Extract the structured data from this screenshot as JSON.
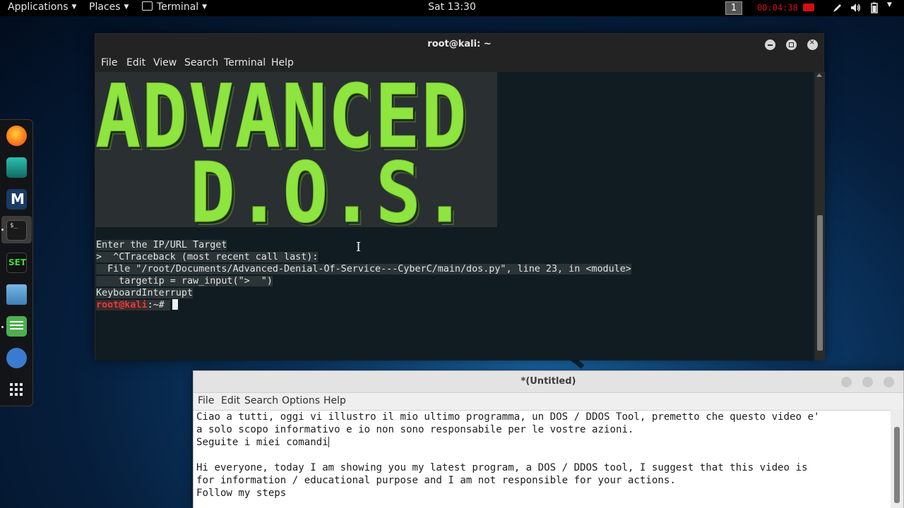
{
  "topbar": {
    "applications": "Applications",
    "places": "Places",
    "terminal": "Terminal",
    "clock": "Sat 13:30",
    "workspace": "1",
    "rec_time": "00:04:38",
    "rec_color": "#d31010"
  },
  "dock": {
    "items": [
      "firefox-icon",
      "maltego-icon",
      "metasploit-icon",
      "terminal-icon",
      "set-icon",
      "files-icon",
      "text-editor-icon",
      "burpsuite-icon",
      "show-apps-icon"
    ],
    "set_label": "SET"
  },
  "terminal": {
    "title": "root@kali: ~",
    "menu": [
      "File",
      "Edit",
      "View",
      "Search",
      "Terminal",
      "Help"
    ],
    "banner": [
      "ADVANCED",
      "D.O.S."
    ],
    "banner_color": "#8ee53f",
    "lines": [
      "Enter the IP/URL Target",
      ">  ^CTraceback (most recent call last):",
      "  File \"/root/Documents/Advanced-Denial-Of-Service---CyberC/main/dos.py\", line 23, in <module>",
      "    targetip = raw_input(\">  \")",
      "KeyboardInterrupt"
    ],
    "prompt_user": "root@kali",
    "prompt_rest": ":~# "
  },
  "editor": {
    "title": "*(Untitled)",
    "menu": [
      "File",
      "Edit",
      "Search",
      "Options",
      "Help"
    ],
    "lines": [
      "Ciao a tutti, oggi vi illustro il mio ultimo programma, un DOS / DDOS Tool, premetto che questo video e'",
      "a solo scopo informativo e io non sono responsabile per le vostre azioni.",
      "Seguite i miei comandi",
      "",
      "Hi everyone, today I am showing you my latest program, a DOS / DDOS tool, I suggest that this video is",
      "for information / educational purpose and I am not responsible for your actions.",
      "Follow my steps"
    ]
  }
}
